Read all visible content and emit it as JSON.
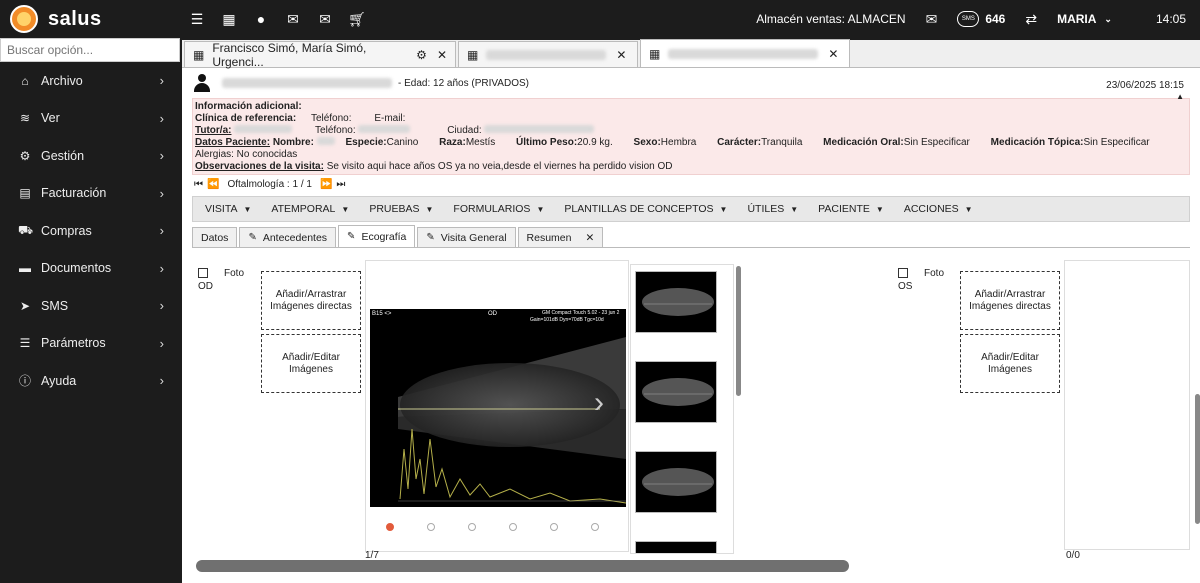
{
  "app": {
    "name": "salus"
  },
  "topbar": {
    "store_label": "Almacén ventas: ALMACEN",
    "sms_count": "646",
    "sms_icon_text": "SMS",
    "user": "MARIA",
    "time": "14:05"
  },
  "sidebar": {
    "search_placeholder": "Buscar opción...",
    "items": [
      {
        "label": "Archivo",
        "icon": "home-icon"
      },
      {
        "label": "Ver",
        "icon": "layers-icon"
      },
      {
        "label": "Gestión",
        "icon": "gear-icon"
      },
      {
        "label": "Facturación",
        "icon": "invoice-icon"
      },
      {
        "label": "Compras",
        "icon": "cart-icon"
      },
      {
        "label": "Documentos",
        "icon": "folder-icon"
      },
      {
        "label": "SMS",
        "icon": "send-icon"
      },
      {
        "label": "Parámetros",
        "icon": "sliders-icon"
      },
      {
        "label": "Ayuda",
        "icon": "info-icon"
      }
    ]
  },
  "tabs": [
    {
      "label": "Francisco Simó, María Simó, Urgenci..."
    },
    {
      "label": ""
    },
    {
      "label": ""
    }
  ],
  "patient": {
    "age": "- Edad: 12 años (PRIVADOS)",
    "datetime": "23/06/2025 18:15",
    "info_title": "Información adicional:",
    "clinic_label": "Clínica de referencia:",
    "phone_label": "Teléfono:",
    "email_label": "E-mail:",
    "tutor_label": "Tutor/a:",
    "phone2_label": "Teléfono:",
    "city_label": "Ciudad:",
    "datos_label": "Datos Paciente:",
    "nombre_label": "Nombre:",
    "especie_label": "Especie:",
    "especie": "Canino",
    "raza_label": "Raza:",
    "raza": "Mestís",
    "peso_label": "Último Peso:",
    "peso": "20.9 kg.",
    "sexo_label": "Sexo:",
    "sexo": "Hembra",
    "caracter_label": "Carácter:",
    "caracter": "Tranquila",
    "med_oral_label": "Medicación Oral:",
    "med_oral": "Sin Especificar",
    "med_top_label": "Medicación Tópica:",
    "med_top": "Sin Especificar",
    "alergias": "Alergias: No conocidas",
    "obs_label": "Observaciones de la visita:",
    "obs": "Se visito aqui hace años OS ya no veia,desde el viernes ha perdido vision OD"
  },
  "pager": {
    "label": "Oftalmología : 1 / 1"
  },
  "menu": [
    "VISITA",
    "ATEMPORAL",
    "PRUEBAS",
    "FORMULARIOS",
    "PLANTILLAS DE CONCEPTOS",
    "ÚTILES",
    "PACIENTE",
    "ACCIONES"
  ],
  "subtabs": [
    "Datos",
    "Antecedentes",
    "Ecografía",
    "Visita General",
    "Resumen"
  ],
  "ecografia": {
    "od_label": "OD",
    "os_label": "OS",
    "foto_label": "Foto",
    "drop_label": "Añadir/Arrastrar Imágenes directas",
    "edit_label": "Añadir/Editar Imágenes",
    "counter_left": "1/7",
    "counter_right": "0/0",
    "us_header_left": "B15 <>",
    "us_header_center": "OD",
    "us_header_right": "GM Compact Touch 5.02 - 23 jun 2",
    "us_header_right2": "Gain=101dB Dyn=70dB Tgc=10d"
  },
  "colors": {
    "accent": "#e25b3b",
    "sidebar_bg": "#1c1c1c",
    "info_bg": "#fbe9e9"
  }
}
